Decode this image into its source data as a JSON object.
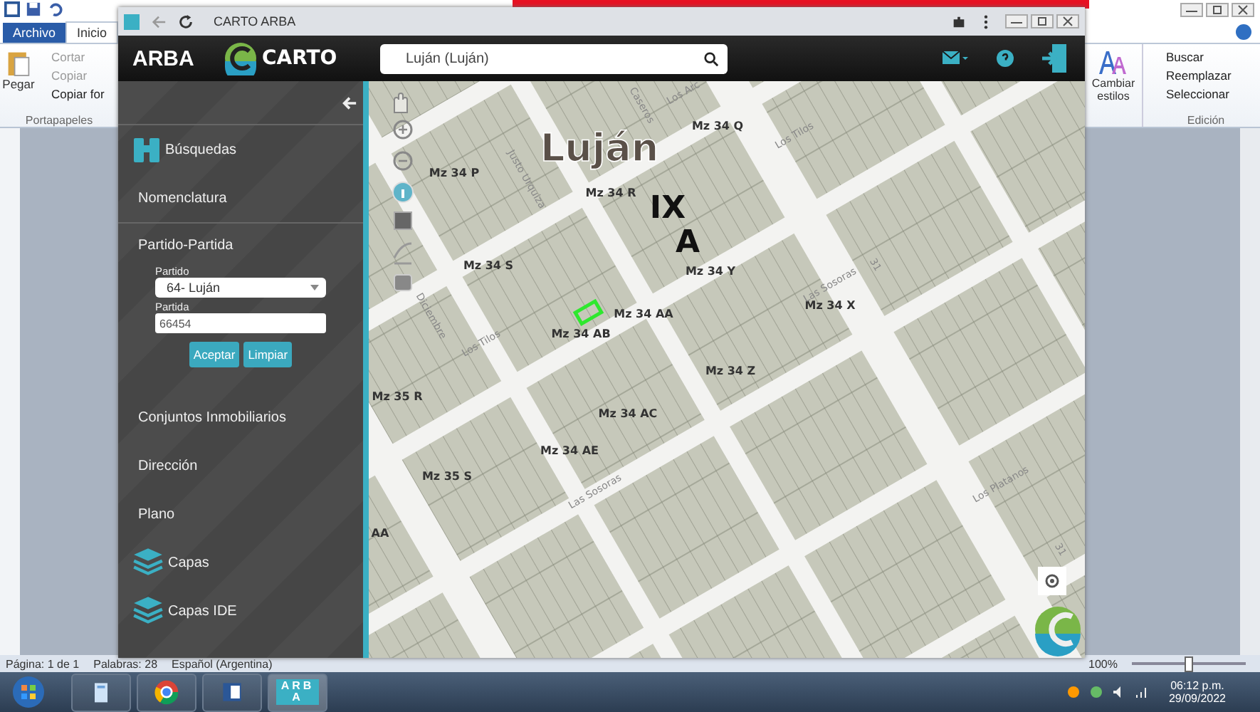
{
  "word": {
    "tabs": [
      {
        "label": "Archivo",
        "selected": false
      },
      {
        "label": "Inicio",
        "selected": true
      }
    ],
    "clipboard": {
      "paste": "Pegar",
      "items": [
        "Cortar",
        "Copiar",
        "Copiar for"
      ],
      "group": "Portapapeles"
    },
    "styles": {
      "label": "Cambiar estilos"
    },
    "editing": {
      "items": [
        "Buscar",
        "Reemplazar",
        "Seleccionar"
      ],
      "group": "Edición"
    },
    "status_bar": {
      "page": "Página: 1 de 1",
      "words": "Palabras: 28",
      "language": "Español (Argentina)",
      "zoom": "100%",
      "zoom_slider": {
        "level": 0.5
      }
    }
  },
  "browser": {
    "title": "CARTO ARBA"
  },
  "app": {
    "brand": "ARBA",
    "logo_text": "CARTO",
    "search": "Luján (Luján)"
  },
  "sidebar": {
    "sections": [
      {
        "kind": "search_heading",
        "label": "Búsquedas"
      },
      {
        "kind": "link",
        "label": "Nomenclatura"
      },
      {
        "kind": "form",
        "label": "Partido-Partida",
        "fields": [
          {
            "kind": "select",
            "label": "Partido",
            "value": "64- Luján"
          },
          {
            "kind": "input",
            "label": "Partida",
            "value": "66454"
          }
        ],
        "buttons": [
          "Aceptar",
          "Limpiar"
        ]
      },
      {
        "kind": "link",
        "label": "Conjuntos Inmobiliarios"
      },
      {
        "kind": "link",
        "label": "Dirección"
      },
      {
        "kind": "link",
        "label": "Plano"
      },
      {
        "kind": "layers",
        "label": "Capas"
      },
      {
        "kind": "layers",
        "label": "Capas IDE"
      }
    ]
  },
  "map": {
    "labels": [
      {
        "kind": "city",
        "text": "Luján"
      },
      {
        "kind": "sector",
        "text": "IX"
      },
      {
        "kind": "sector",
        "text": "A"
      },
      {
        "kind": "block",
        "text": "Mz 34 Q"
      },
      {
        "kind": "block",
        "text": "Mz 34 P"
      },
      {
        "kind": "block",
        "text": "Mz 34 R"
      },
      {
        "kind": "block",
        "text": "Mz 34 S"
      },
      {
        "kind": "block",
        "text": "Mz 34 Y"
      },
      {
        "kind": "block",
        "text": "Mz 34 AA"
      },
      {
        "kind": "block",
        "text": "Mz 34 AB"
      },
      {
        "kind": "block",
        "text": "Mz 34 X"
      },
      {
        "kind": "block",
        "text": "Mz 34 Z"
      },
      {
        "kind": "block",
        "text": "Mz 34 AC"
      },
      {
        "kind": "block",
        "text": "Mz 34 AE"
      },
      {
        "kind": "block",
        "text": "Mz 35 R"
      },
      {
        "kind": "block",
        "text": "Mz 35 S"
      },
      {
        "kind": "block",
        "text": "AA"
      },
      {
        "kind": "street",
        "text": "Caseros"
      },
      {
        "kind": "street",
        "text": "Los Arc"
      },
      {
        "kind": "street",
        "text": "Los Tilos"
      },
      {
        "kind": "street",
        "text": "Justo Urquiza"
      },
      {
        "kind": "street",
        "text": "Diciembre"
      },
      {
        "kind": "street",
        "text": "Los Tilos"
      },
      {
        "kind": "street",
        "text": "Las Sosoras"
      },
      {
        "kind": "street",
        "text": "Las Sosoras"
      },
      {
        "kind": "street",
        "text": "Los Platanos"
      },
      {
        "kind": "street",
        "text": "31"
      },
      {
        "kind": "street",
        "text": "31"
      }
    ]
  },
  "taskbar": {
    "apps": [
      {
        "kind": "explorer",
        "selected": false
      },
      {
        "kind": "chrome",
        "selected": false
      },
      {
        "kind": "word",
        "selected": false
      },
      {
        "kind": "arba",
        "label": "ARBA",
        "selected": true
      }
    ],
    "time": "06:12 p.m.",
    "date": "29/09/2022"
  }
}
